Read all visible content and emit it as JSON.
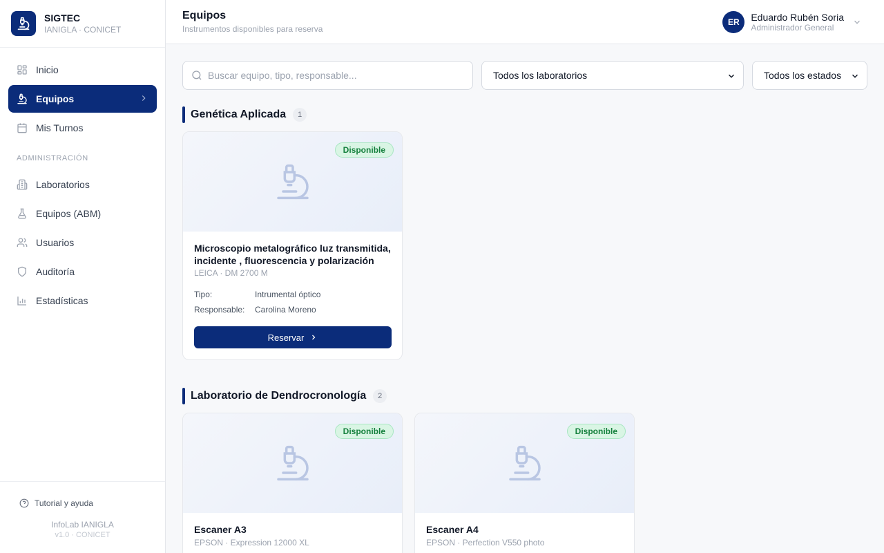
{
  "app": {
    "title": "SIGTEC",
    "subtitle": "IANIGLA · CONICET"
  },
  "sidebar": {
    "items": [
      {
        "label": "Inicio",
        "icon": "grid-icon"
      },
      {
        "label": "Equipos",
        "icon": "microscope-icon",
        "active": true
      },
      {
        "label": "Mis Turnos",
        "icon": "calendar-icon"
      }
    ],
    "section_label": "ADMINISTRACIÓN",
    "admin_items": [
      {
        "label": "Laboratorios",
        "icon": "building-icon"
      },
      {
        "label": "Equipos (ABM)",
        "icon": "flask-icon"
      },
      {
        "label": "Usuarios",
        "icon": "users-icon"
      },
      {
        "label": "Auditoría",
        "icon": "shield-icon"
      },
      {
        "label": "Estadísticas",
        "icon": "bar-chart-icon"
      }
    ],
    "help_label": "Tutorial y ayuda",
    "footer_line1": "InfoLab IANIGLA",
    "footer_line2": "v1.0 · CONICET"
  },
  "header": {
    "title": "Equipos",
    "subtitle": "Instrumentos disponibles para reserva",
    "user_initials": "ER",
    "user_name": "Eduardo Rubén Soria",
    "user_role": "Administrador General"
  },
  "filters": {
    "search_placeholder": "Buscar equipo, tipo, responsable...",
    "lab_select": "Todos los laboratorios",
    "state_select": "Todos los estados"
  },
  "sections": [
    {
      "title": "Genética Aplicada",
      "count": "1",
      "cards": [
        {
          "status": "Disponible",
          "title": "Microscopio metalográfico luz transmitida, incidente , fluorescencia y polarización",
          "model": "LEICA · DM 2700 M",
          "tipo_label": "Tipo:",
          "tipo": "Intrumental óptico",
          "resp_label": "Responsable:",
          "responsable": "Carolina Moreno",
          "button": "Reservar"
        }
      ]
    },
    {
      "title": "Laboratorio de Dendrocronología",
      "count": "2",
      "cards": [
        {
          "status": "Disponible",
          "title": "Escaner A3",
          "model": "EPSON · Expression 12000 XL"
        },
        {
          "status": "Disponible",
          "title": "Escaner A4",
          "model": "EPSON · Perfection V550 photo"
        }
      ]
    }
  ],
  "colors": {
    "brand": "#0b2c7a",
    "available_bg": "#d9f5e4",
    "available_text": "#15803d"
  }
}
